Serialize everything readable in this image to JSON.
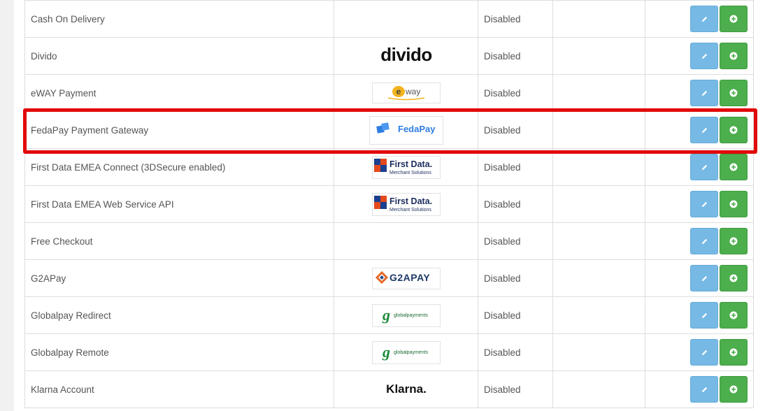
{
  "extensions": [
    {
      "name": "Cash On Delivery",
      "logo": null,
      "status": "Disabled"
    },
    {
      "name": "Divido",
      "logo": {
        "type": "divido",
        "text": "divido"
      },
      "status": "Disabled"
    },
    {
      "name": "eWAY Payment",
      "logo": {
        "type": "eway",
        "text": "eway"
      },
      "status": "Disabled"
    },
    {
      "name": "FedaPay Payment Gateway",
      "logo": {
        "type": "fedapay",
        "text": "FedaPay"
      },
      "status": "Disabled",
      "highlighted": true
    },
    {
      "name": "First Data EMEA Connect (3DSecure enabled)",
      "logo": {
        "type": "firstdata",
        "text": "First Data.",
        "subtext": "Merchant Solutions"
      },
      "status": "Disabled"
    },
    {
      "name": "First Data EMEA Web Service API",
      "logo": {
        "type": "firstdata",
        "text": "First Data.",
        "subtext": "Merchant Solutions"
      },
      "status": "Disabled"
    },
    {
      "name": "Free Checkout",
      "logo": null,
      "status": "Disabled"
    },
    {
      "name": "G2APay",
      "logo": {
        "type": "g2apay",
        "text": "G2APAY"
      },
      "status": "Disabled"
    },
    {
      "name": "Globalpay Redirect",
      "logo": {
        "type": "globalpay",
        "text": "globalpayments"
      },
      "status": "Disabled"
    },
    {
      "name": "Globalpay Remote",
      "logo": {
        "type": "globalpay",
        "text": "globalpayments"
      },
      "status": "Disabled"
    },
    {
      "name": "Klarna Account",
      "logo": {
        "type": "klarna",
        "text": "Klarna."
      },
      "status": "Disabled"
    }
  ],
  "icons": {
    "edit": "pencil-icon",
    "install": "plus-circle-icon"
  },
  "colors": {
    "edit_button": "#76b9e5",
    "install_button": "#4cae4c",
    "highlight": "#e10a0a"
  }
}
